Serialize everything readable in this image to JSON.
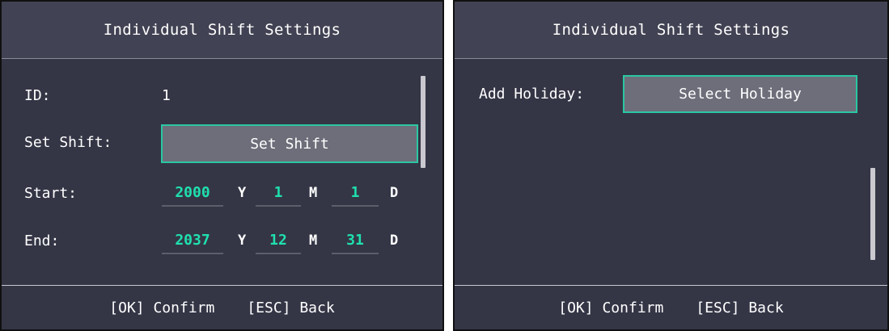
{
  "left": {
    "title": "Individual Shift Settings",
    "id_label": "ID:",
    "id_value": "1",
    "shift_label": "Set Shift:",
    "shift_button": "Set Shift",
    "start_label": "Start:",
    "start": {
      "year": "2000",
      "month": "1",
      "day": "1"
    },
    "end_label": "End:",
    "end": {
      "year": "2037",
      "month": "12",
      "day": "31"
    },
    "unit_y": "Y",
    "unit_m": "M",
    "unit_d": "D",
    "confirm": "[OK] Confirm",
    "back": "[ESC] Back"
  },
  "right": {
    "title": "Individual Shift Settings",
    "holiday_label": "Add Holiday:",
    "holiday_button": "Select Holiday",
    "confirm": "[OK] Confirm",
    "back": "[ESC] Back"
  },
  "colors": {
    "accent": "#2ac7a3",
    "value_text": "#1fe0ae",
    "background": "#343646"
  }
}
